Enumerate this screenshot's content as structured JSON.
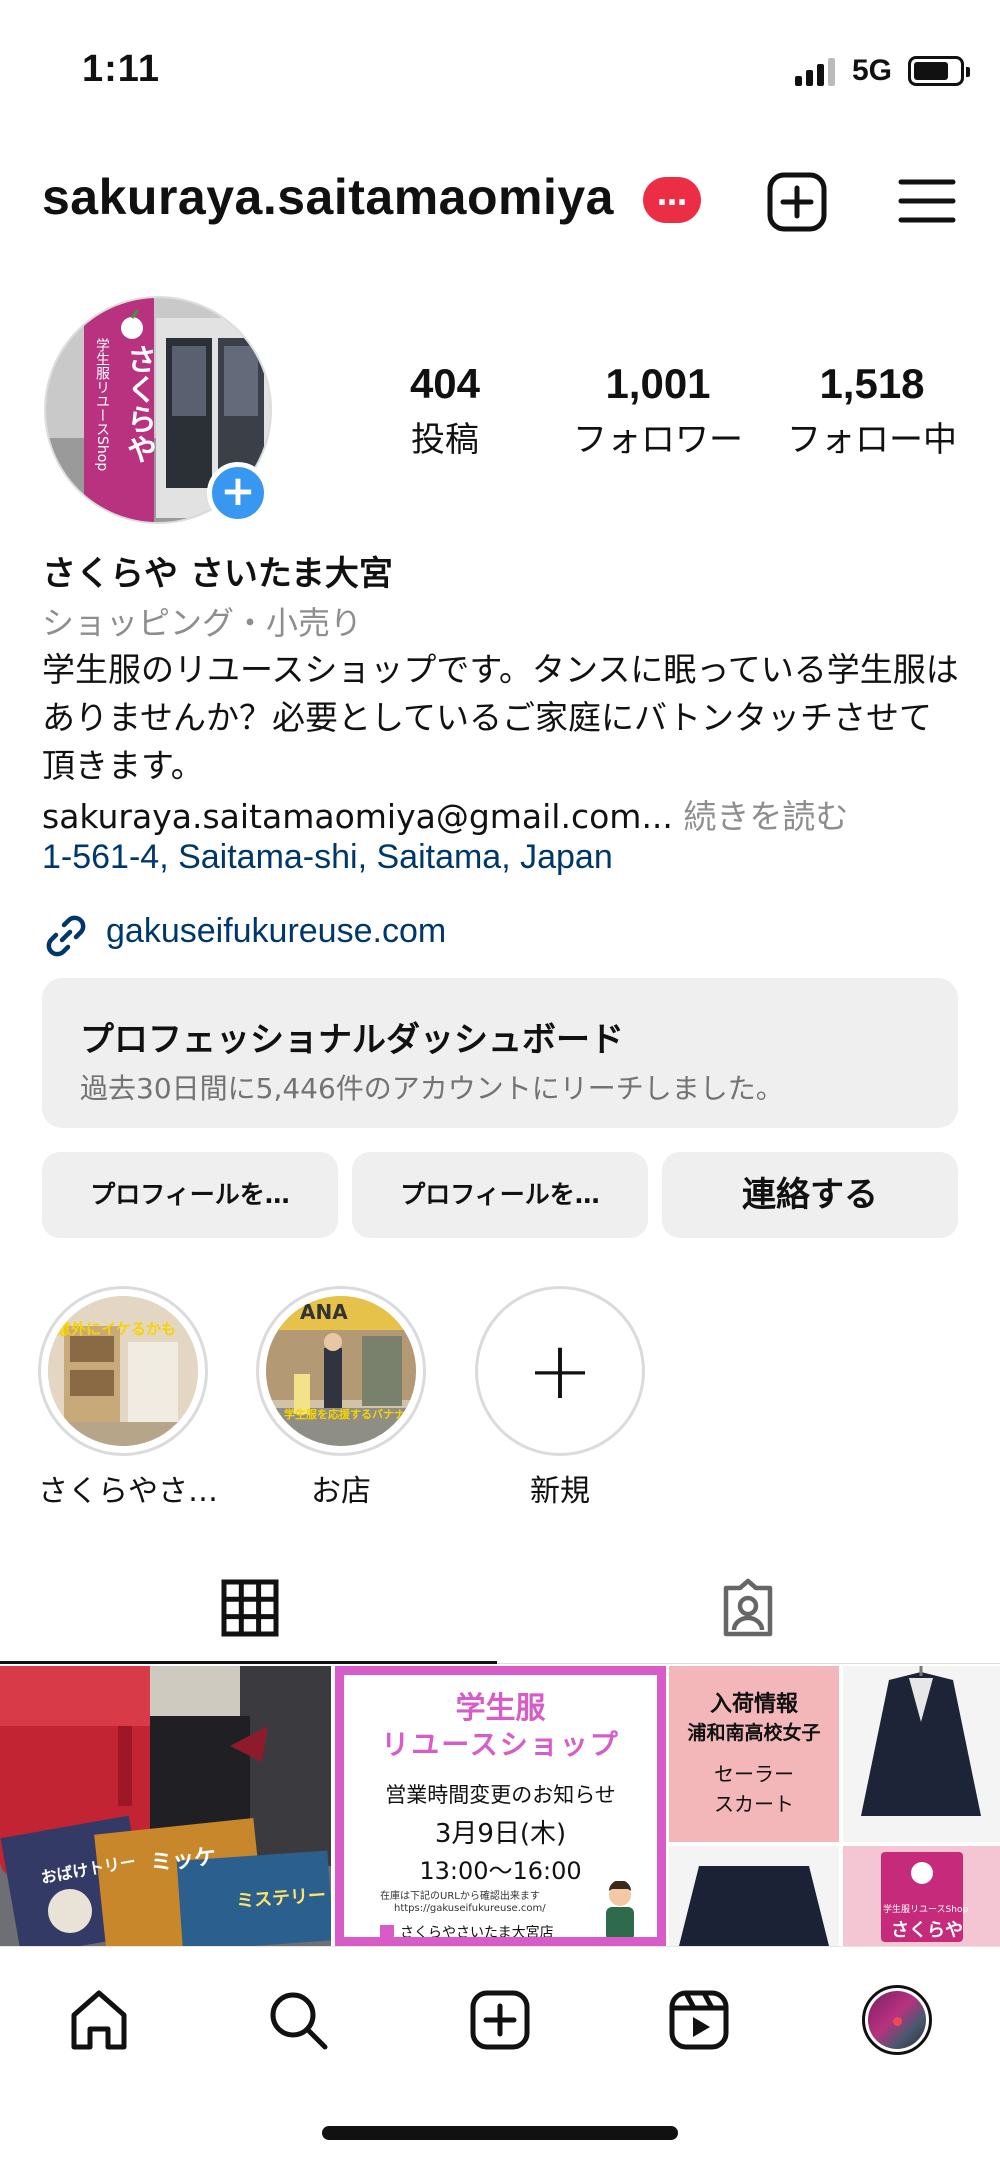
{
  "status_bar": {
    "time": "1:11",
    "network": "5G"
  },
  "header": {
    "username": "sakuraya.saitamaomiya",
    "badge": "…"
  },
  "profile": {
    "avatar_sign_text": "さくらや",
    "avatar_sign_sub": "学生服リユースShop",
    "stats": [
      {
        "value": "404",
        "label": "投稿"
      },
      {
        "value": "1,001",
        "label": "フォロワー"
      },
      {
        "value": "1,518",
        "label": "フォロー中"
      }
    ],
    "display_name": "さくらや さいたま大宮",
    "category": "ショッピング・小売り",
    "bio": "学生服のリユースショップです。タンスに眠っている学生服はありませんか？必要としているご家庭にバトンタッチさせて頂きます。",
    "email": "sakuraya.saitamaomiya@gmail.com...",
    "more": "続きを読む",
    "address": "1-561-4, Saitama-shi, Saitama, Japan",
    "link": "gakuseifukureuse.com"
  },
  "dashboard": {
    "title": "プロフェッショナルダッシュボード",
    "subtitle": "過去30日間に5,446件のアカウントにリーチしました。"
  },
  "buttons": {
    "edit_profile": "プロフィールを…",
    "share_profile": "プロフィールを…",
    "contact": "連絡する"
  },
  "highlights": [
    {
      "label": "さくらやさ…",
      "overlay": "意外にイケるかも"
    },
    {
      "label": "お店",
      "overlay": "学生服を応援するバナナ",
      "sign": "ANA"
    },
    {
      "label": "新規",
      "symbol": "+"
    }
  ],
  "posts": [
    {
      "book1": "おばけトリー",
      "book2": "ミッケ",
      "book3": "ミステリー"
    },
    {
      "title1": "学生服",
      "title2": "リユースショップ",
      "notice": "営業時間変更のお知らせ",
      "date": "3月9日(木)",
      "hours": "13:00〜16:00",
      "small1": "在庫は下記のURLから確認出来ます",
      "small2": "https://gakuseifukureuse.com/",
      "shop": "さくらやさいたま大宮店"
    },
    {
      "line1": "入荷情報",
      "line2": "浦和南高校女子",
      "line3": "セーラー",
      "line4": "スカート",
      "logo_sub": "学生服リユースShop",
      "logo": "さくらや"
    }
  ],
  "colors": {
    "link": "#00376b",
    "badge": "#ec2e45",
    "add": "#3897f0",
    "button_bg": "#efefef",
    "pink": "#b8327f"
  },
  "icons": {
    "header": [
      "plus-square-icon",
      "menu-icon"
    ],
    "tabs": [
      "grid-icon",
      "tagged-icon"
    ],
    "nav": [
      "home-icon",
      "search-icon",
      "create-icon",
      "reels-icon",
      "profile-avatar"
    ]
  }
}
